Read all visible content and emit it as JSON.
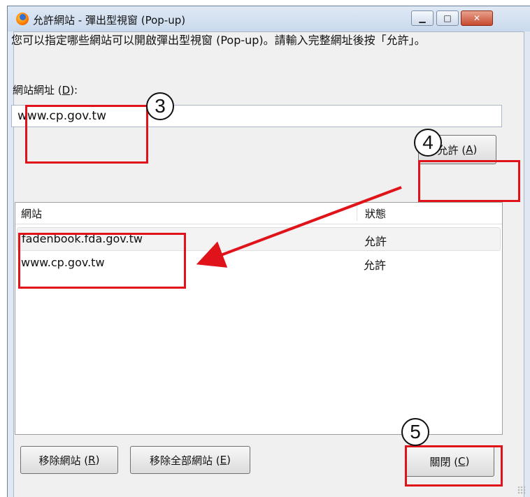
{
  "window": {
    "title": "允許網站 - 彈出型視窗 (Pop-up)",
    "controls": {
      "minimize": "▁",
      "maximize": "□",
      "close": "✕"
    }
  },
  "description": "您可以指定哪些網站可以開啟彈出型視窗 (Pop-up)。請輸入完整網址後按「允許」。",
  "site_field": {
    "label_text": "網站網址 (",
    "label_key": "D",
    "label_end": "):",
    "value": "www.cp.gov.tw"
  },
  "allow_button": {
    "text": "允許 (",
    "key": "A",
    "end": ")"
  },
  "table": {
    "columns": [
      "網站",
      "狀態"
    ],
    "rows": [
      {
        "site": "fadenbook.fda.gov.tw",
        "status": "允許"
      },
      {
        "site": "www.cp.gov.tw",
        "status": "允許"
      }
    ]
  },
  "buttons": {
    "remove": {
      "text": "移除網站 (",
      "key": "R",
      "end": ")"
    },
    "remove_all": {
      "text": "移除全部網站 (",
      "key": "E",
      "end": ")"
    },
    "close": {
      "text": "關閉 (",
      "key": "C",
      "end": ")"
    }
  },
  "callouts": [
    "3",
    "4",
    "5"
  ],
  "annotation_color": "#e0131b"
}
